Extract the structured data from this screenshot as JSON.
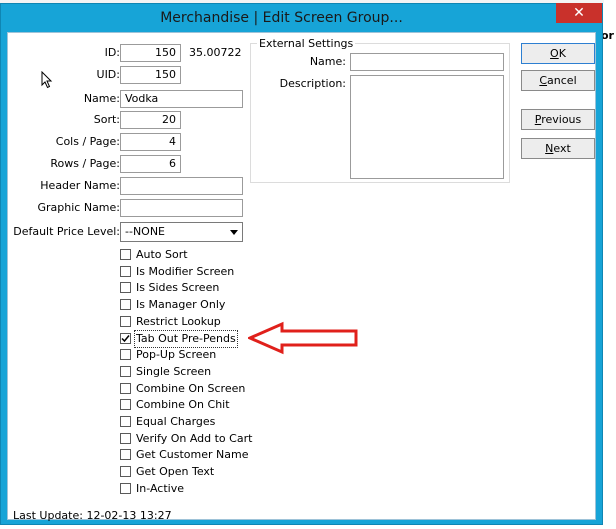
{
  "window": {
    "title": "Merchandise | Edit Screen Group...",
    "close_glyph": "✕"
  },
  "background": {
    "fragment_text": "or"
  },
  "fields": {
    "id": {
      "label": "ID:",
      "value": "150",
      "extra": "35.00722"
    },
    "uid": {
      "label": "UID:",
      "value": "150"
    },
    "name": {
      "label": "Name:",
      "value": "Vodka"
    },
    "sort": {
      "label": "Sort:",
      "value": "20"
    },
    "cols_page": {
      "label": "Cols / Page:",
      "value": "4"
    },
    "rows_page": {
      "label": "Rows / Page:",
      "value": "6"
    },
    "header_name": {
      "label": "Header Name:",
      "value": ""
    },
    "graphic_name": {
      "label": "Graphic Name:",
      "value": ""
    },
    "default_price_level": {
      "label": "Default Price Level:",
      "value": "--NONE"
    }
  },
  "options": [
    {
      "label": "Auto Sort",
      "checked": false
    },
    {
      "label": "Is Modifier Screen",
      "checked": false
    },
    {
      "label": "Is Sides Screen",
      "checked": false
    },
    {
      "label": "Is Manager Only",
      "checked": false
    },
    {
      "label": "Restrict Lookup",
      "checked": false
    },
    {
      "label": "Tab Out Pre-Pends",
      "checked": true
    },
    {
      "label": "Pop-Up Screen",
      "checked": false
    },
    {
      "label": "Single Screen",
      "checked": false
    },
    {
      "label": "Combine On Screen",
      "checked": false
    },
    {
      "label": "Combine On Chit",
      "checked": false
    },
    {
      "label": "Equal Charges",
      "checked": false
    },
    {
      "label": "Verify On Add to Cart",
      "checked": false
    },
    {
      "label": "Get Customer Name",
      "checked": false
    },
    {
      "label": "Get Open Text",
      "checked": false
    },
    {
      "label": "In-Active",
      "checked": false
    }
  ],
  "external_settings": {
    "title": "External Settings",
    "name_label": "Name:",
    "name_value": "",
    "description_label": "Description:",
    "description_value": ""
  },
  "buttons": {
    "ok": {
      "mnemonic": "O",
      "rest": "K"
    },
    "cancel": {
      "mnemonic": "C",
      "rest": "ancel"
    },
    "previous": {
      "mnemonic": "P",
      "rest": "revious"
    },
    "next": {
      "mnemonic": "N",
      "rest": "ext"
    }
  },
  "footer": {
    "last_update": "Last Update: 12-02-13 13:27"
  },
  "colors": {
    "titlebar": "#17a4d7",
    "close": "#c9312b",
    "annotation_arrow": "#e0201b"
  }
}
